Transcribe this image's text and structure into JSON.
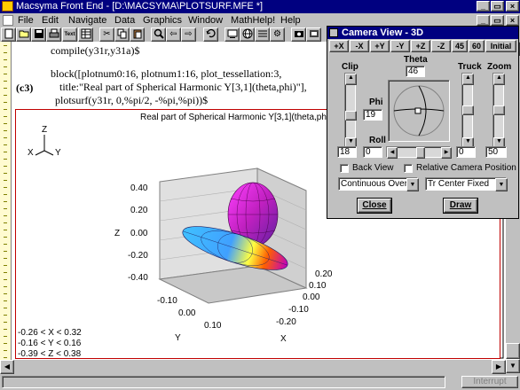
{
  "window": {
    "title": "Macsyma Front End - [D:\\MACSYMA\\PLOTSURF.MFE *]"
  },
  "menu": [
    "File",
    "Edit",
    "Navigate",
    "Data",
    "Graphics",
    "Window",
    "MathHelp!",
    "Help"
  ],
  "toolbar": {
    "text_label": "Text",
    "icons": [
      "new-page-icon",
      "open-folder-icon",
      "save-disk-icon",
      "print-icon",
      "text-cell-icon",
      "table-icon",
      "cut-scissors-icon",
      "copy-icon",
      "paste-icon",
      "search-icon",
      "arrow-left-icon",
      "arrow-right-icon",
      "undo-icon",
      "interrupt-icon",
      "screen-icon",
      "globe-icon",
      "lines-icon",
      "settings-icon",
      "camera-icon",
      "film-icon",
      "graph-icon",
      "help-question-icon"
    ]
  },
  "notebook": {
    "line1": "compile(y31r,y31a)$",
    "cell_label": "(c3)",
    "line2": "block([plotnum0:16, plotnum1:16, plot_tessellation:3,",
    "line3": "title:\"Real part of Spherical Harmonic Y[3,1](theta,phi)\"],",
    "line4": "plotsurf(y31r, 0,%pi/2, -%pi,%pi))$"
  },
  "plot": {
    "title": "Real part of Spherical Harmonic Y[3,1](theta,phi)",
    "axis_triad": {
      "z": "Z",
      "x": "X",
      "y": "Y"
    },
    "z_label": "Z",
    "y_label": "Y",
    "x_label": "X",
    "z_ticks": [
      "0.40",
      "0.20",
      "0.00",
      "-0.20",
      "-0.40"
    ],
    "y_ticks": [
      "-0.10",
      "0.00",
      "0.10"
    ],
    "x_ticks": [
      "0.20",
      "0.10",
      "0.00",
      "-0.10",
      "-0.20"
    ],
    "ranges": [
      "-0.26 < X < 0.32",
      "-0.16 < Y < 0.16",
      "-0.39 < Z < 0.38"
    ]
  },
  "status": {
    "interrupt_label": "Interrupt"
  },
  "camera": {
    "title": "Camera View - 3D",
    "buttons": [
      "+X",
      "-X",
      "+Y",
      "-Y",
      "+Z",
      "-Z",
      "45",
      "60",
      "Initial"
    ],
    "clip_label": "Clip",
    "theta_label": "Theta",
    "theta_value": "46",
    "truck_label": "Truck",
    "zoom_label": "Zoom",
    "phi_label": "Phi",
    "phi_value": "19",
    "roll_label": "Roll",
    "clip_value": "18",
    "roll_value": "0",
    "truck_value": "0",
    "zoom_value": "50",
    "back_view_label": "Back View",
    "relative_label": "Relative Camera Position",
    "mode_select": "Continuous Overla",
    "center_select": "Tr Center Fixed",
    "close_label": "Close",
    "draw_label": "Draw"
  },
  "colors": {
    "title_bar": "#000080",
    "cell_bracket": "#c00000",
    "window_bg": "#c0c0c0"
  }
}
